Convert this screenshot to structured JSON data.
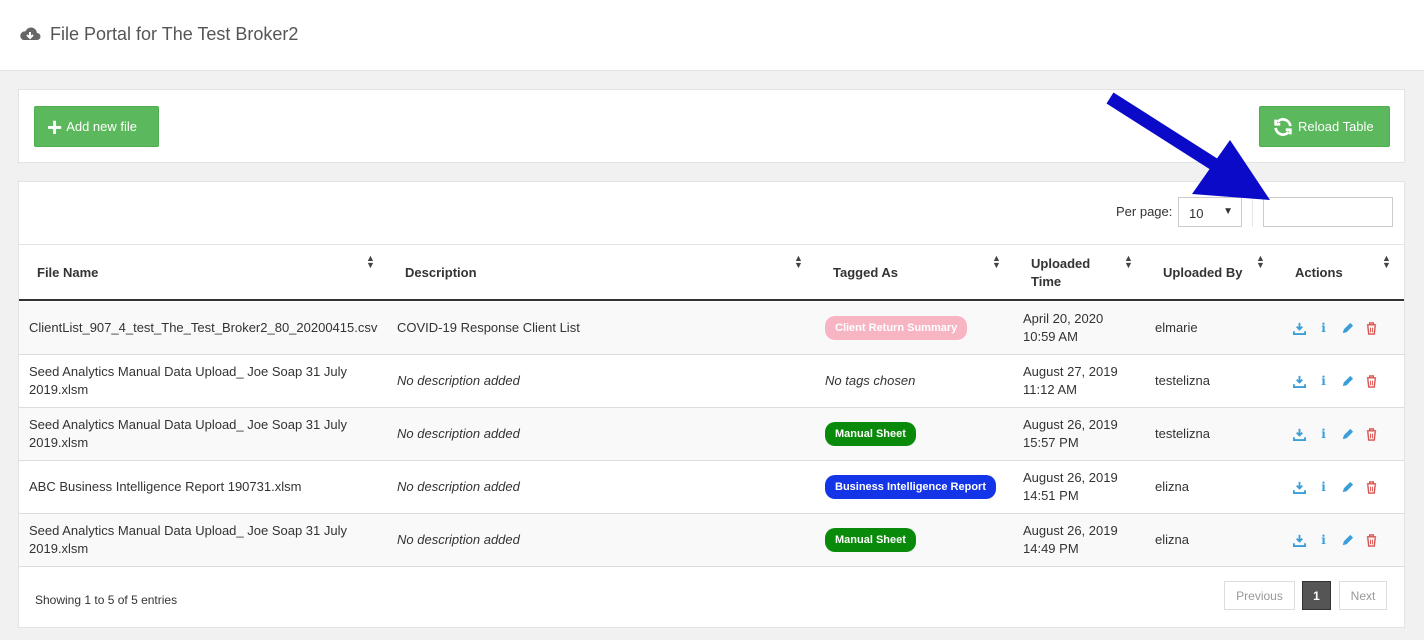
{
  "header": {
    "title": "File Portal for The Test Broker2",
    "icon": "cloud-download-icon"
  },
  "toolbar": {
    "add_label": "Add new file",
    "reload_label": "Reload Table"
  },
  "table_controls": {
    "per_page_label": "Per page:",
    "per_page_value": "10",
    "search_value": ""
  },
  "columns": {
    "file_name": "File Name",
    "description": "Description",
    "tagged_as": "Tagged As",
    "uploaded_time": "Uploaded Time",
    "uploaded_by": "Uploaded By",
    "actions": "Actions"
  },
  "rows": [
    {
      "file": "ClientList_907_4_test_The_Test_Broker2_80_20200415.csv",
      "description": "COVID-19 Response Client List",
      "tag": "Client Return Summary",
      "tag_color": "#f7b5c4",
      "time1": "April 20, 2020",
      "time2": "10:59 AM",
      "by": "elmarie"
    },
    {
      "file": "Seed Analytics Manual Data Upload_ Joe Soap 31 July 2019.xlsm",
      "description": "No description added",
      "tag": "No tags chosen",
      "tag_color": "",
      "time1": "August 27, 2019",
      "time2": "11:12 AM",
      "by": "testelizna"
    },
    {
      "file": "Seed Analytics Manual Data Upload_ Joe Soap 31 July 2019.xlsm",
      "description": "No description added",
      "tag": "Manual Sheet",
      "tag_color": "#0a8a0a",
      "time1": "August 26, 2019",
      "time2": "15:57 PM",
      "by": "testelizna"
    },
    {
      "file": "ABC Business Intelligence Report 190731.xlsm",
      "description": "No description added",
      "tag": "Business Intelligence Report",
      "tag_color": "#1434e8",
      "time1": "August 26, 2019",
      "time2": "14:51 PM",
      "by": "elizna"
    },
    {
      "file": "Seed Analytics Manual Data Upload_ Joe Soap 31 July 2019.xlsm",
      "description": "No description added",
      "tag": "Manual Sheet",
      "tag_color": "#0a8a0a",
      "time1": "August 26, 2019",
      "time2": "14:49 PM",
      "by": "elizna"
    }
  ],
  "footer": {
    "showing": "Showing 1 to 5 of 5 entries",
    "prev": "Previous",
    "page": "1",
    "next": "Next"
  },
  "colors": {
    "green": "#5cb85c",
    "action_blue": "#3a9fd8",
    "action_red": "#d9534f",
    "arrow": "#0a0ac8"
  }
}
